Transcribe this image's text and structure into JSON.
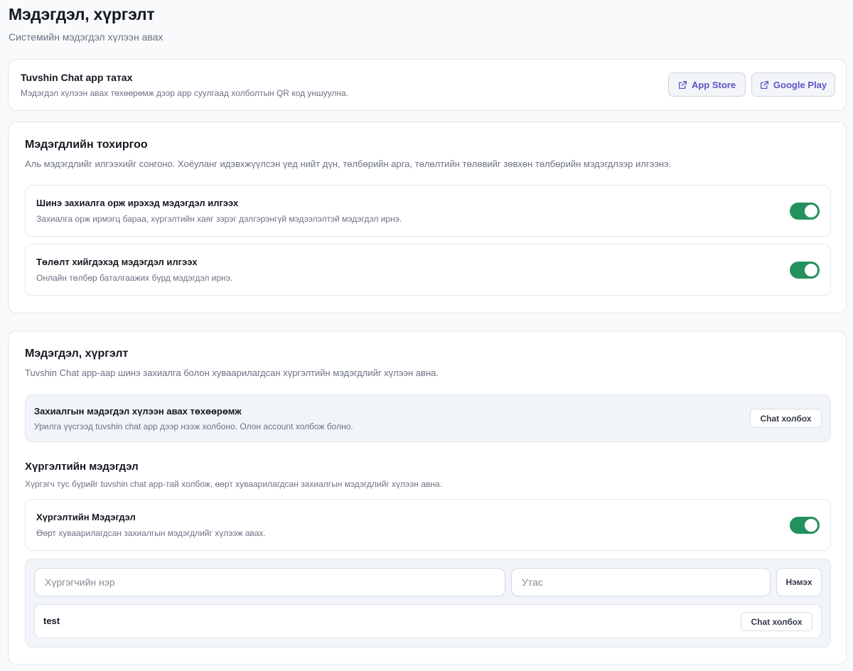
{
  "page": {
    "title": "Мэдэгдэл, хүргэлт",
    "subtitle": "Системийн мэдэгдэл хүлээн авах"
  },
  "app_card": {
    "title": "Tuvshin Chat app татах",
    "description": "Мэдэгдэл хүлээн авах төхөөрөмж дээр app суулгаад холболтын QR код уншуулна.",
    "app_store_label": "App Store",
    "google_play_label": "Google Play"
  },
  "settings": {
    "title": "Мэдэгдлийн тохиргоо",
    "description": "Аль мэдэгдлийг илгээхийг сонгоно. Хоёуланг идэвхжүүлсэн үед нийт дүн, төлбөрийн арга, төлөлтийн төлөвийг зөвхөн төлбөрийн мэдэгдлээр илгээнэ.",
    "items": [
      {
        "title": "Шинэ захиалга орж ирэхэд мэдэгдэл илгээх",
        "description": "Захиалга орж ирмэгц бараа, хүргэлтийн хаяг зэрэг дэлгэрэнгүй мэдээлэлтэй мэдэгдэл ирнэ.",
        "enabled": true
      },
      {
        "title": "Төлөлт хийгдэхэд мэдэгдэл илгээх",
        "description": "Онлайн төлбөр баталгаажих бүрд мэдэгдэл ирнэ.",
        "enabled": true
      }
    ]
  },
  "notify": {
    "title": "Мэдэгдэл, хүргэлт",
    "description": "Tuvshin Chat app-аар шинэ захиалга болон хуваарилагдсан хүргэлтийн мэдэгдлийг хүлээн авна.",
    "device": {
      "title": "Захиалгын мэдэгдэл хүлээн авах төхөөрөмж",
      "description": "Урилга үүсгээд tuvshin chat app дээр нээж холбоно. Олон account холбож болно.",
      "button_label": "Chat холбох"
    },
    "delivery": {
      "title": "Хүргэлтийн мэдэгдэл",
      "description": "Хүргэгч тус бүрийг tuvshin chat app-тай холбож, өөрт хуваарилагдсан захиалгын мэдэгдлийг хүлээн авна.",
      "toggle_title": "Хүргэлтийн Мэдэгдэл",
      "toggle_description": "Өөрт хуваарилагдсан захиалгын мэдэгдлийг хүлээж авах.",
      "enabled": true,
      "name_placeholder": "Хүргэгчийн нэр",
      "phone_placeholder": "Утас",
      "add_label": "Нэмэх",
      "couriers": [
        {
          "name": "test",
          "button_label": "Chat холбох"
        }
      ]
    }
  },
  "colors": {
    "accent": "#5a55c8",
    "toggle_on": "#23915d",
    "panel_bg": "#f1f4f9"
  }
}
